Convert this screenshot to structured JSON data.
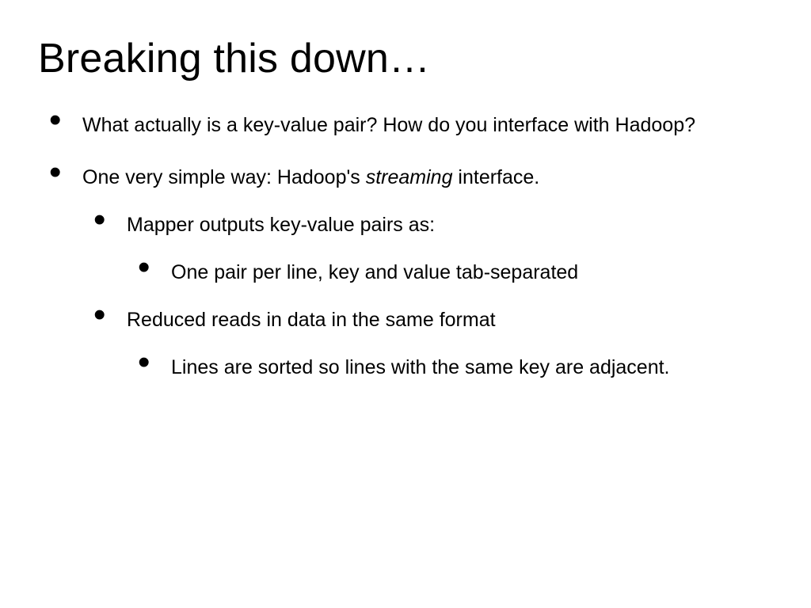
{
  "title": "Breaking this down…",
  "bullets": {
    "b1": "What actually is a key-value pair?  How do you interface with Hadoop?",
    "b2_pre": "One very simple way: Hadoop's ",
    "b2_em": "streaming",
    "b2_post": " interface.",
    "b2_1": "Mapper outputs key-value pairs as:",
    "b2_1_1": "One pair per line, key and value tab-separated",
    "b2_2": "Reduced reads in data in the same format",
    "b2_2_1": "Lines are sorted so lines with the same key are adjacent."
  }
}
